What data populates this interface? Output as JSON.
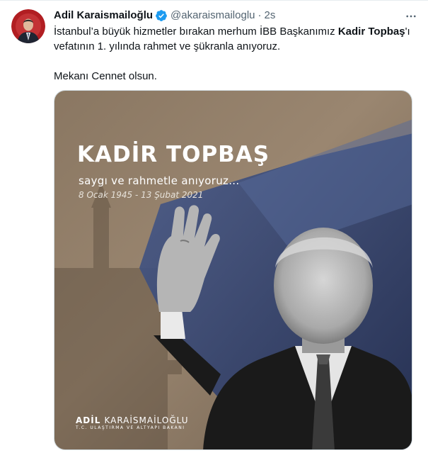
{
  "tweet": {
    "author": {
      "display_name": "Adil Karaismailoğlu",
      "handle": "@akaraismailoglu",
      "verified": true,
      "avatar_icon": "profile-photo"
    },
    "separator": "·",
    "timestamp": "2s",
    "more_icon": "more-horizontal-icon",
    "text": {
      "line1_pre": "İstanbul’a büyük hizmetler bırakan merhum İBB Başkanımız ",
      "line1_bold": "Kadir Topbaş",
      "line1_post": "'ı vefatının 1. yılında rahmet ve şükranla anıyoruz.",
      "line2": "Mekanı Cennet olsun."
    },
    "image": {
      "title": "KADİR TOPBAŞ",
      "subtitle": "saygı ve rahmetle anıyoruz...",
      "dates": "8 Ocak 1945 - 13 Şubat 2021",
      "brand_first": "ADİL",
      "brand_last": "KARAİSMAİLOĞLU",
      "brand_sub": "T.C. ULAŞTIRMA VE ALTYAPI BAKANI"
    }
  },
  "colors": {
    "text_primary": "#0f1419",
    "text_secondary": "#536471",
    "verified_blue": "#1d9bf0",
    "image_bg_brown": "#8a7560",
    "image_blue": "#2d3f6e"
  }
}
